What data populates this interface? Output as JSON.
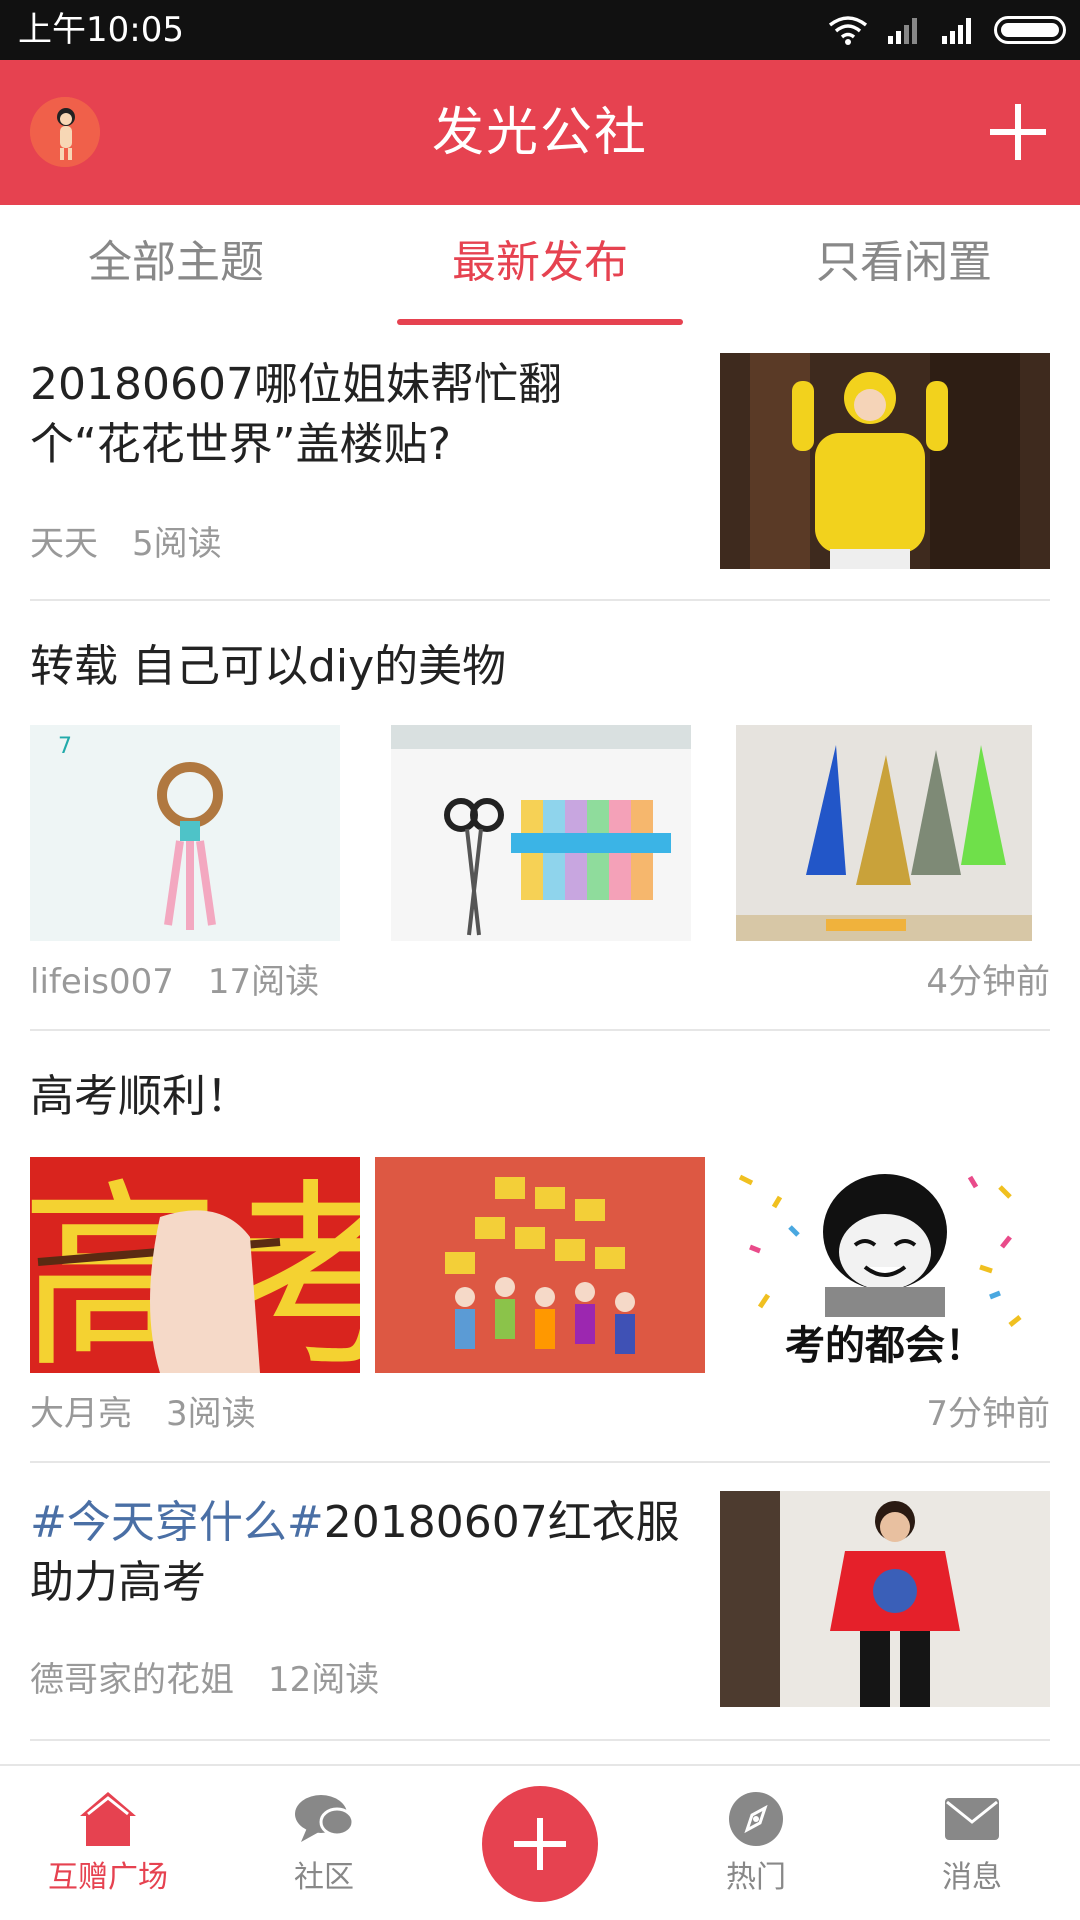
{
  "status_bar": {
    "time": "上午10:05"
  },
  "header": {
    "title": "发光公社"
  },
  "tabs": [
    {
      "label": "全部主题",
      "active": false
    },
    {
      "label": "最新发布",
      "active": true
    },
    {
      "label": "只看闲置",
      "active": false
    }
  ],
  "posts": [
    {
      "title_line1": "20180607哪位姐妹帮忙翻",
      "title_line2": "个“花花世界”盖楼贴?",
      "author": "天天",
      "reads": "5阅读",
      "image_desc": "child-in-yellow-costume"
    },
    {
      "title": "转载 自己可以diy的美物",
      "author": "lifeis007",
      "reads": "17阅读",
      "time_ago": "4分钟前",
      "images": [
        "diy-ring-tassel",
        "scissors-and-threads",
        "colorful-tassels"
      ]
    },
    {
      "title": "高考顺利！",
      "author": "大月亮",
      "reads": "3阅读",
      "time_ago": "7分钟前",
      "images": [
        "hand-holding-pencil-gaokao",
        "cartoon-crowd-cheering",
        "meme-kaodedouhui"
      ],
      "meme_caption": "考的都会！",
      "gaokao_chars": [
        "高",
        "考"
      ]
    },
    {
      "hashtag": "#今天穿什么#",
      "title_rest": "20180607红衣服",
      "title_line2": "助力高考",
      "author": "德哥家的花姐",
      "reads": "12阅读",
      "image_desc": "woman-in-red-tshirt"
    }
  ],
  "bottom_nav": [
    {
      "label": "互赠广场",
      "icon": "home-icon",
      "active": true
    },
    {
      "label": "社区",
      "icon": "chat-bubble-icon",
      "active": false
    },
    {
      "label": "",
      "icon": "plus-icon",
      "active": false
    },
    {
      "label": "热门",
      "icon": "compass-icon",
      "active": false
    },
    {
      "label": "消息",
      "icon": "mail-icon",
      "active": false
    }
  ],
  "colors": {
    "accent": "#e64250",
    "muted": "#999999",
    "hashtag": "#4a6fa5"
  }
}
